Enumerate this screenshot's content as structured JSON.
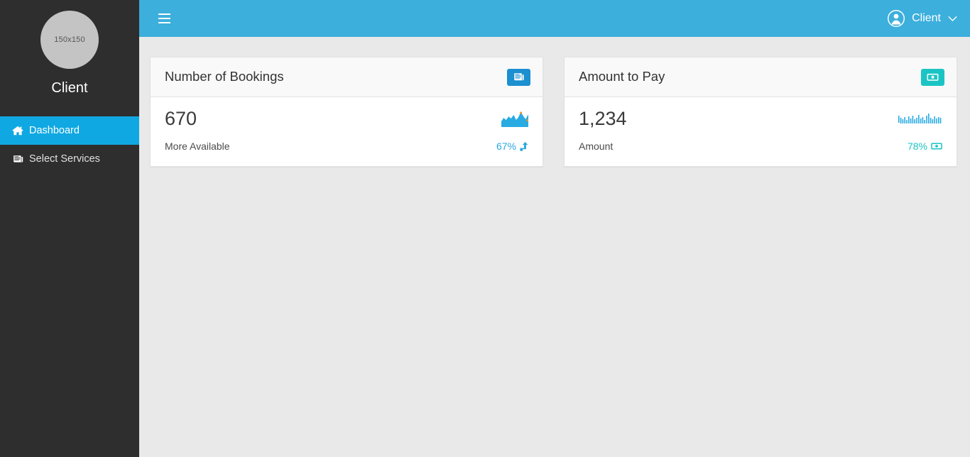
{
  "sidebar": {
    "avatar_placeholder": "150x150",
    "avatar_icon": "avatar-placeholder",
    "profile_name": "Client",
    "items": [
      {
        "label": "Dashboard",
        "icon": "home-icon",
        "active": true
      },
      {
        "label": "Select Services",
        "icon": "newspaper-icon",
        "active": false
      }
    ]
  },
  "topbar": {
    "menu_toggle_icon": "hamburger-icon",
    "user_icon": "user-circle-icon",
    "user_name": "Client",
    "caret_icon": "chevron-down-icon",
    "background_color": "#3cafdd"
  },
  "cards": [
    {
      "title": "Number of Bookings",
      "header_icon": "newspaper-icon",
      "header_icon_color": "#1b8fd0",
      "value": "670",
      "label": "More Available",
      "percent": "67%",
      "percent_color": "#2ba6e0",
      "percent_icon": "level-up-arrow-icon",
      "sparkline_type": "area"
    },
    {
      "title": "Amount to Pay",
      "header_icon": "money-bill-icon",
      "header_icon_color": "#1bc4c4",
      "value": "1,234",
      "label": "Amount",
      "percent": "78%",
      "percent_color": "#1bc4c4",
      "percent_icon": "money-bill-icon",
      "sparkline_type": "bar"
    }
  ],
  "chart_data": [
    {
      "type": "area",
      "title": "Number of Bookings sparkline",
      "x": [
        0,
        1,
        2,
        3,
        4,
        5,
        6,
        7,
        8,
        9,
        10,
        11
      ],
      "values": [
        4,
        7,
        5,
        8,
        6,
        9,
        5,
        7,
        12,
        8,
        6,
        10
      ],
      "ylim": [
        0,
        13
      ],
      "series_color": "#29abe2",
      "highlight_color": "#f7941e",
      "highlight_index": 11,
      "xlabel": "",
      "ylabel": "",
      "grid": false,
      "legend": "none"
    },
    {
      "type": "bar",
      "title": "Amount to Pay sparkline",
      "categories": [
        "1",
        "2",
        "3",
        "4",
        "5",
        "6",
        "7",
        "8",
        "9",
        "10",
        "11",
        "12",
        "13",
        "14",
        "15",
        "16",
        "17",
        "18",
        "19",
        "20",
        "21",
        "22"
      ],
      "values": [
        9,
        6,
        4,
        7,
        3,
        8,
        5,
        9,
        4,
        6,
        10,
        5,
        7,
        3,
        9,
        12,
        6,
        4,
        8,
        5,
        7,
        6
      ],
      "ylim": [
        0,
        13
      ],
      "series_color": "#29abe2",
      "xlabel": "",
      "ylabel": "",
      "grid": false,
      "legend": "none"
    }
  ]
}
